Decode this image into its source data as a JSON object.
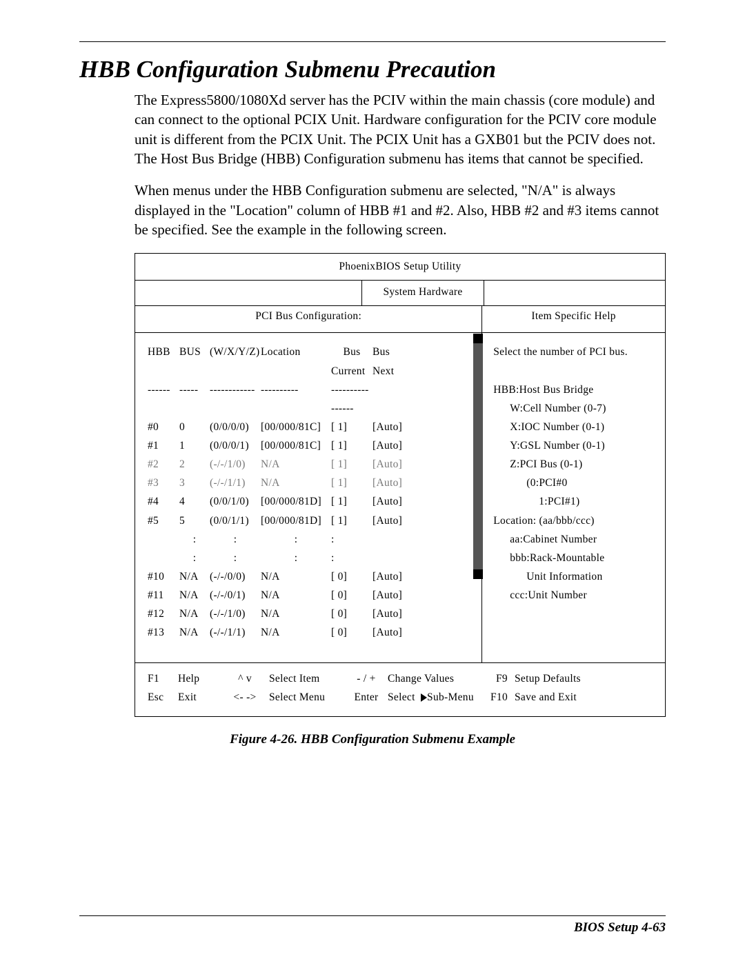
{
  "title": "HBB Configuration Submenu Precaution",
  "para1": "The Express5800/1080Xd server has the PCIV within the main chassis (core module) and can connect to the optional PCIX Unit. Hardware configuration for the PCIV core module unit is different from the PCIX Unit. The PCIX Unit has a GXB01 but the PCIV does not. The Host Bus Bridge (HBB) Configuration submenu has items that cannot be specified.",
  "para2": "When menus under the HBB Configuration submenu are selected, \"N/A\" is always displayed in the \"Location\" column of HBB #1 and #2. Also, HBB #2 and #3 items cannot be specified. See the example in the following screen.",
  "bios": {
    "header": "PhoenixBIOS   Setup   Utility",
    "tab": "System Hardware",
    "left_title": "PCI Bus Configuration:",
    "right_title": "Item Specific Help",
    "columns": {
      "hbb": "HBB",
      "bus": "BUS",
      "wxyz": "(W/X/Y/Z)",
      "loc": "Location",
      "buscur": "Bus",
      "busnext": "Bus",
      "cur": "Current",
      "next": "Next"
    },
    "rows": [
      {
        "hbb": "#0",
        "bus": "0",
        "wxyz": "(0/0/0/0)",
        "loc": "[00/000/81C]",
        "cur": "[   1]",
        "next": "[Auto]",
        "grey": false
      },
      {
        "hbb": "#1",
        "bus": "1",
        "wxyz": "(0/0/0/1)",
        "loc": "[00/000/81C]",
        "cur": "[   1]",
        "next": "[Auto]",
        "grey": false
      },
      {
        "hbb": "#2",
        "bus": "2",
        "wxyz": "(-/-/1/0)",
        "loc": "N/A",
        "cur": "[   1]",
        "next": "[Auto]",
        "grey": true
      },
      {
        "hbb": "#3",
        "bus": "3",
        "wxyz": "(-/-/1/1)",
        "loc": "N/A",
        "cur": "[   1]",
        "next": "[Auto]",
        "grey": true
      },
      {
        "hbb": "#4",
        "bus": "4",
        "wxyz": "(0/0/1/0)",
        "loc": "[00/000/81D]",
        "cur": "[   1]",
        "next": "[Auto]",
        "grey": false
      },
      {
        "hbb": "#5",
        "bus": "5",
        "wxyz": "(0/0/1/1)",
        "loc": "[00/000/81D]",
        "cur": "[   1]",
        "next": "[Auto]",
        "grey": false
      }
    ],
    "rows2": [
      {
        "hbb": "#10",
        "bus": "N/A",
        "wxyz": "(-/-/0/0)",
        "loc": "N/A",
        "cur": "[   0]",
        "next": "[Auto]"
      },
      {
        "hbb": "#11",
        "bus": "N/A",
        "wxyz": "(-/-/0/1)",
        "loc": "N/A",
        "cur": "[   0]",
        "next": "[Auto]"
      },
      {
        "hbb": "#12",
        "bus": "N/A",
        "wxyz": "(-/-/1/0)",
        "loc": "N/A",
        "cur": "[   0]",
        "next": "[Auto]"
      },
      {
        "hbb": "#13",
        "bus": "N/A",
        "wxyz": "(-/-/1/1)",
        "loc": "N/A",
        "cur": "[   0]",
        "next": "[Auto]"
      }
    ],
    "help": {
      "l1": "Select the number of PCI bus.",
      "l2": "HBB:Host Bus Bridge",
      "l3": "W:Cell Number (0-7)",
      "l4": "X:IOC Number (0-1)",
      "l5": "Y:GSL Number (0-1)",
      "l6": "Z:PCI Bus      (0-1)",
      "l7": "(0:PCI#0",
      "l8": "1:PCI#1)",
      "l9": "Location: (aa/bbb/ccc)",
      "l10": "aa:Cabinet Number",
      "l11": "bbb:Rack-Mountable",
      "l12": "Unit Information",
      "l13": "ccc:Unit Number"
    },
    "footer": {
      "r1": {
        "k1": "F1",
        "l1": "Help",
        "ar": "^ v",
        "act": "Select Item",
        "ch": "- / +",
        "cv": "Change Values",
        "fk": "F9",
        "fl": "Setup Defaults"
      },
      "r2": {
        "k1": "Esc",
        "l1": "Exit",
        "ar": "<- ->",
        "act": "Select Menu",
        "ch": "Enter",
        "cv": "Select   Sub-Menu",
        "fk": "F10",
        "fl": "Save and Exit"
      }
    }
  },
  "figure_caption": "Figure 4-26.  HBB Configuration Submenu Example",
  "page_footer": "BIOS Setup   4-63"
}
